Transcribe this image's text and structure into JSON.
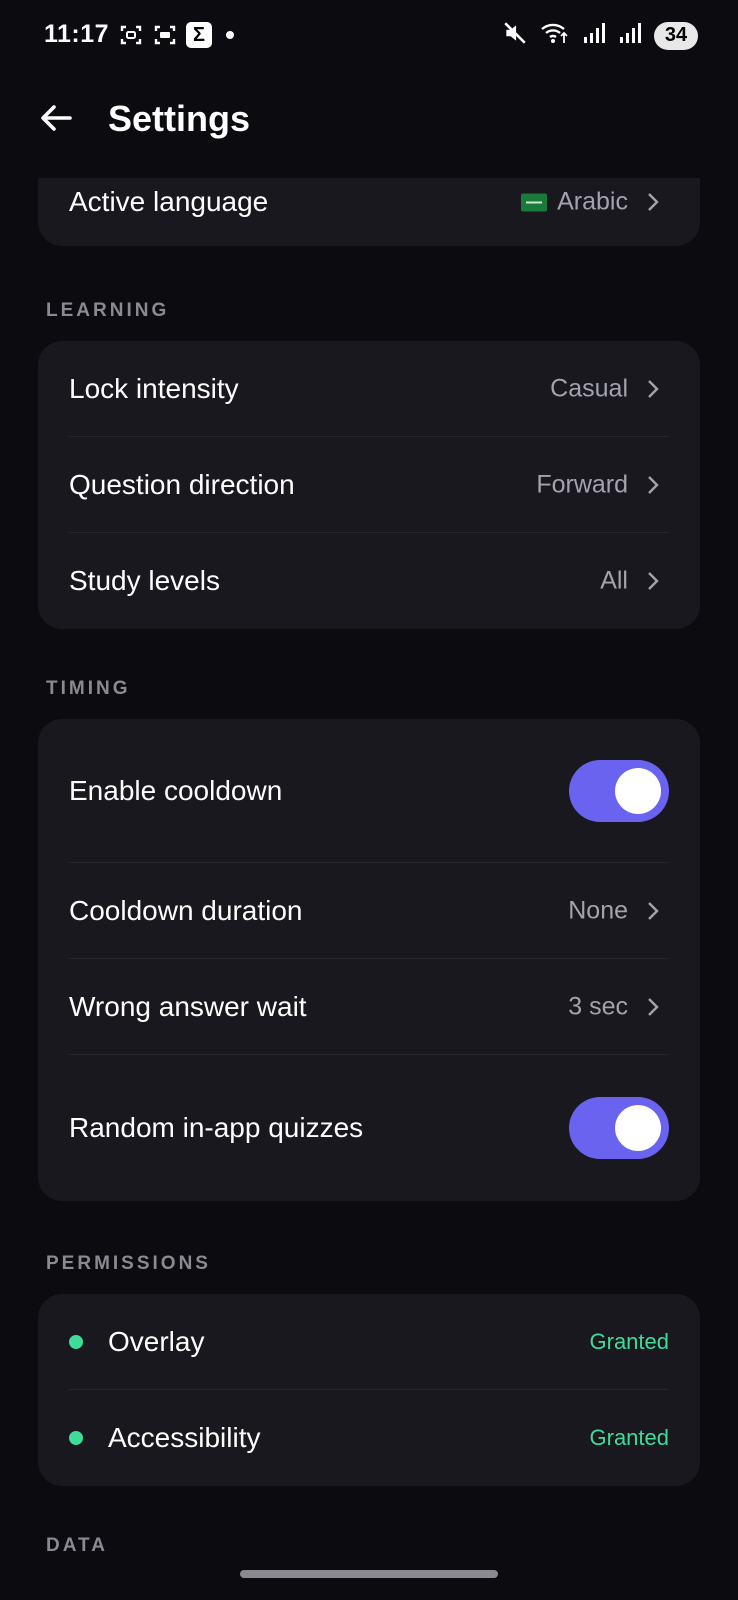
{
  "status_bar": {
    "time": "11:17",
    "battery": "34"
  },
  "header": {
    "title": "Settings"
  },
  "general": {
    "active_language_label": "Active language",
    "active_language_value": "Arabic"
  },
  "learning": {
    "section_label": "LEARNING",
    "rows": [
      {
        "label": "Lock intensity",
        "value": "Casual"
      },
      {
        "label": "Question direction",
        "value": "Forward"
      },
      {
        "label": "Study levels",
        "value": "All"
      }
    ]
  },
  "timing": {
    "section_label": "TIMING",
    "enable_cooldown_label": "Enable cooldown",
    "enable_cooldown_on": true,
    "cooldown_duration_label": "Cooldown duration",
    "cooldown_duration_value": "None",
    "wrong_answer_wait_label": "Wrong answer wait",
    "wrong_answer_wait_value": "3 sec",
    "random_quizzes_label": "Random in-app quizzes",
    "random_quizzes_on": true
  },
  "permissions": {
    "section_label": "PERMISSIONS",
    "items": [
      {
        "label": "Overlay",
        "status": "Granted"
      },
      {
        "label": "Accessibility",
        "status": "Granted"
      }
    ]
  },
  "data_section": {
    "section_label": "DATA"
  },
  "colors": {
    "accent": "#6a63f0",
    "granted": "#3ddc97",
    "language_value": "#8e86ff"
  }
}
